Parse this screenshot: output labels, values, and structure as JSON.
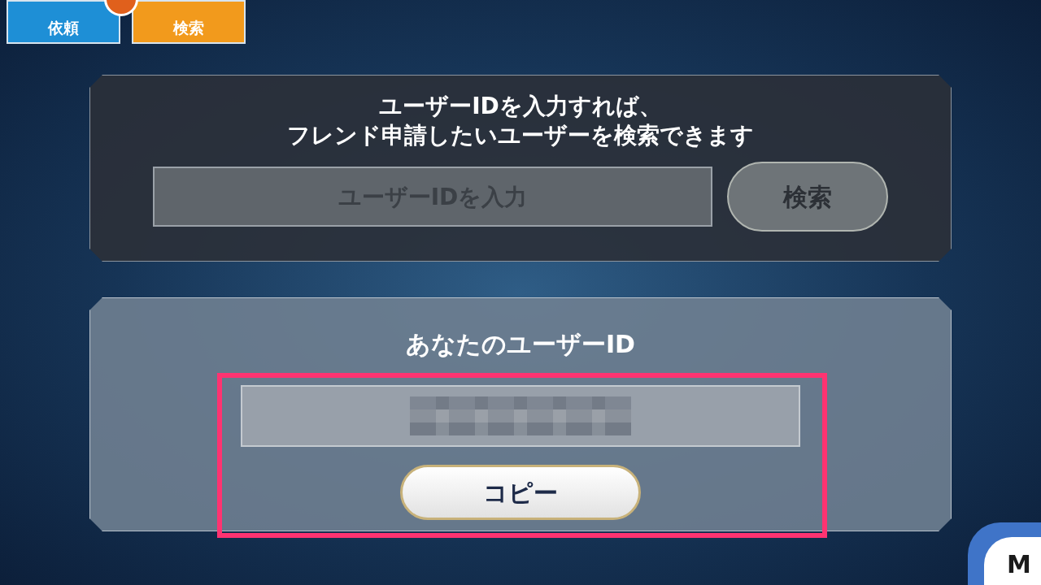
{
  "tabs": [
    {
      "label": "依頼",
      "color": "#1e8fd6"
    },
    {
      "label": "検索",
      "color": "#f29a1c"
    }
  ],
  "search_panel": {
    "message_lines": [
      "ユーザーIDを入力すれば、",
      "フレンド申請したいユーザーを検索できます"
    ],
    "field": {
      "placeholder": "ユーザーIDを入力"
    },
    "button": "検索"
  },
  "id_panel": {
    "title": "あなたのユーザーID",
    "button": "コピー"
  },
  "corner_button": "M"
}
